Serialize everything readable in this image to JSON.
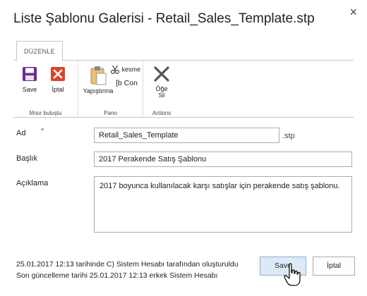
{
  "dialog": {
    "title": "Liste Şablonu Galerisi - Retail_Sales_Template.stp",
    "close_glyph": "×"
  },
  "ribbon": {
    "tab_label": "DÜZENLE",
    "groups": [
      {
        "label": "Mısır buluştu",
        "buttons": [
          {
            "label": "Save",
            "icon": "save-icon"
          },
          {
            "label": "İptal",
            "icon": "cancel-icon"
          }
        ]
      },
      {
        "label": "Pano",
        "large": {
          "label": "Yapıştırma",
          "icon": "paste-icon"
        },
        "small": [
          {
            "label": "kesme",
            "icon": "scissors-icon"
          },
          {
            "label": "[b Con",
            "icon": "copy-icon"
          }
        ]
      },
      {
        "label": "Actions",
        "buttons": [
          {
            "label_line1": "Öğe",
            "label_line2": "Sil",
            "icon": "delete-icon"
          }
        ]
      }
    ]
  },
  "form": {
    "name": {
      "label": "Ad",
      "required_mark": "*",
      "value": "Retail_Sales_Template",
      "suffix": ".stp"
    },
    "title": {
      "label": "Başlık",
      "value": "2017 Perakende Satış Şablonu"
    },
    "description": {
      "label": "Açıklama",
      "value": "2017 boyunca kullanılacak karşı satışlar için perakende satış şablonu."
    }
  },
  "footer": {
    "created": "25.01.2017 12:13 tarihinde C) Sistem Hesabı tarafından oluşturuldu",
    "modified": "Son güncelleme tarihi 25.01.2017 12:13 erkek Sistem Hesabı",
    "save_label": "Save",
    "cancel_label": "İptal"
  },
  "colors": {
    "accent": "#1e6fd9",
    "save_icon": "#6b2c91",
    "cancel_icon": "#d9452b",
    "delete_icon": "#555555"
  }
}
